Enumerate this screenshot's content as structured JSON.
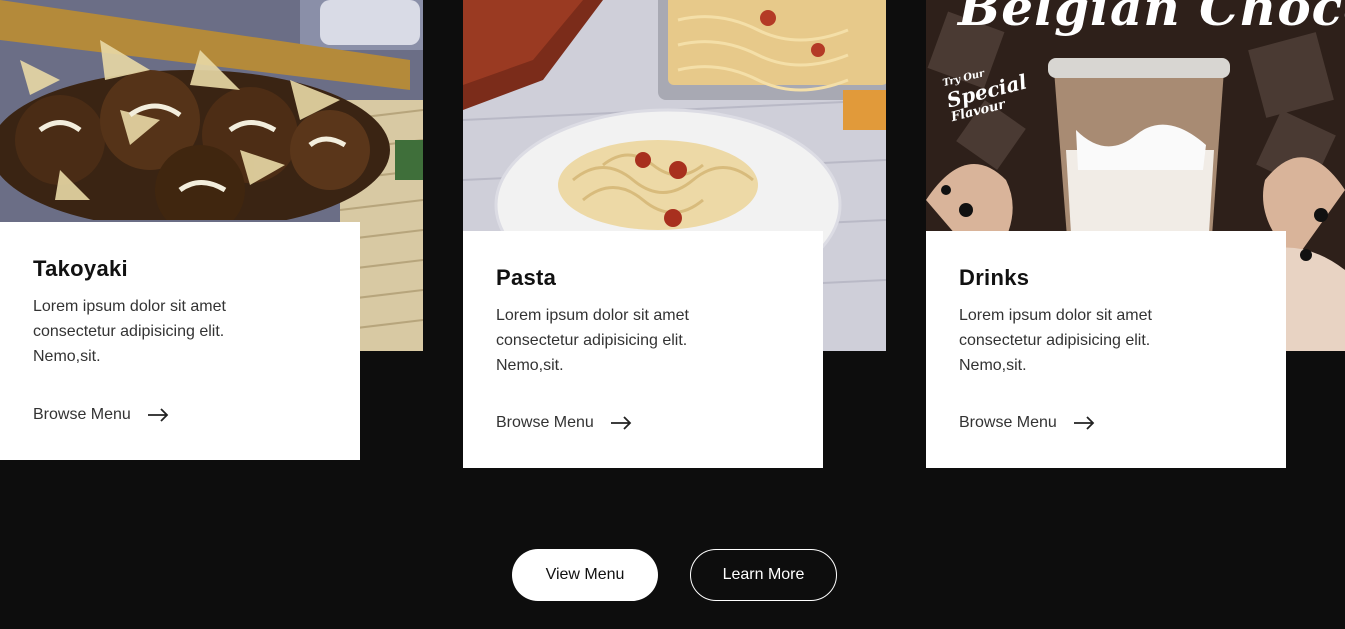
{
  "cards": [
    {
      "title": "Takoyaki",
      "description": "Lorem ipsum dolor sit amet consectetur adipisicing elit. Nemo,sit.",
      "link_label": "Browse Menu",
      "image_icon": "takoyaki-photo"
    },
    {
      "title": "Pasta",
      "description": "Lorem ipsum dolor sit amet consectetur adipisicing elit. Nemo,sit.",
      "link_label": "Browse Menu",
      "image_icon": "pasta-photo"
    },
    {
      "title": "Drinks",
      "description": "Lorem ipsum dolor sit amet consectetur adipisicing elit. Nemo,sit.",
      "link_label": "Browse Menu",
      "image_icon": "drink-photo",
      "promo": {
        "headline": "Belgian Choco",
        "tag_line1": "Try Our",
        "tag_line2": "Special",
        "tag_line3": "Flavour"
      }
    }
  ],
  "actions": {
    "view_menu": "View Menu",
    "learn_more": "Learn More"
  },
  "colors": {
    "background": "#0d0d0d",
    "card": "#ffffff",
    "text": "#111111"
  }
}
